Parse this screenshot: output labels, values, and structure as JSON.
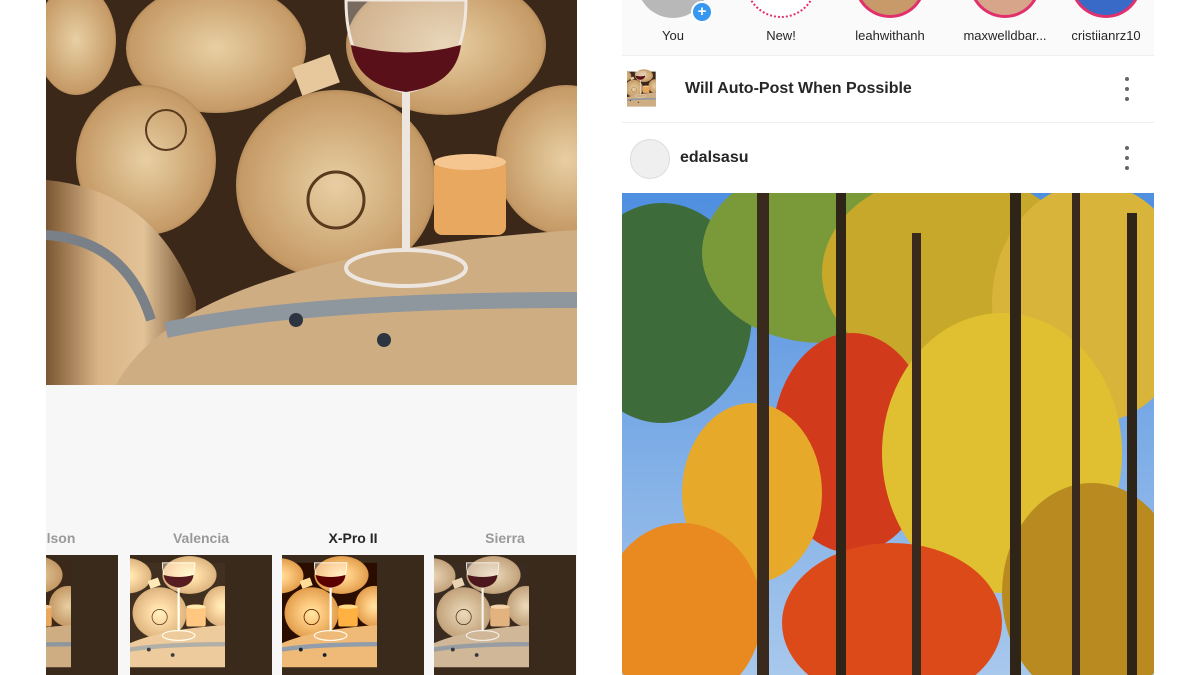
{
  "editor": {
    "filters": [
      {
        "label": "lson",
        "active": false
      },
      {
        "label": "Valencia",
        "active": false
      },
      {
        "label": "X-Pro II",
        "active": true
      },
      {
        "label": "Sierra",
        "active": false
      }
    ]
  },
  "feed": {
    "stories": [
      {
        "label": "You"
      },
      {
        "label": "New!"
      },
      {
        "label": "leahwithanh"
      },
      {
        "label": "maxwelldbar..."
      },
      {
        "label": "cristiianrz10"
      }
    ],
    "pending_post": {
      "status": "Will Auto-Post When Possible"
    },
    "post": {
      "username": "edalsasu"
    }
  },
  "colors": {
    "story_ring": "#e1306c",
    "add_badge": "#3897f0",
    "active_filter": "#262626",
    "inactive_filter": "#9a9a9a"
  }
}
